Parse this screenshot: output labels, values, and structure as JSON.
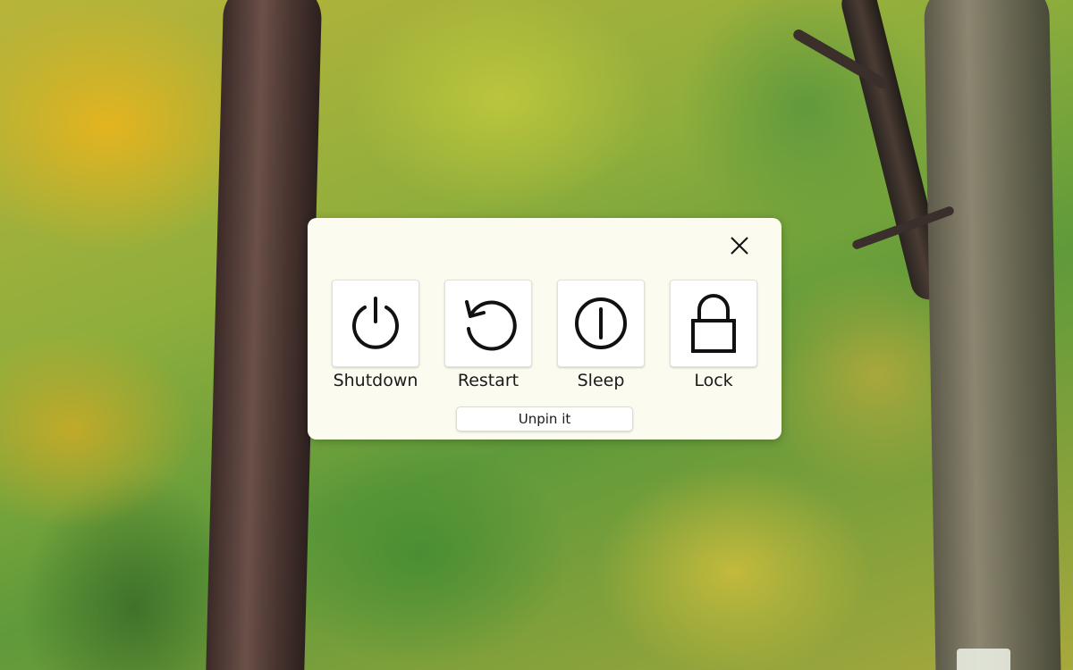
{
  "wallpaper": {
    "description_icon": "forest-wallpaper"
  },
  "dialog": {
    "close_icon": "close-icon",
    "actions": [
      {
        "label": "Shutdown",
        "icon": "power-icon"
      },
      {
        "label": "Restart",
        "icon": "restart-icon"
      },
      {
        "label": "Sleep",
        "icon": "sleep-icon"
      },
      {
        "label": "Lock",
        "icon": "lock-icon"
      }
    ],
    "unpin_label": "Unpin it"
  },
  "colors": {
    "panel_background": "#fbfbf0",
    "tile_background": "#ffffff",
    "icon_stroke": "#111111"
  }
}
